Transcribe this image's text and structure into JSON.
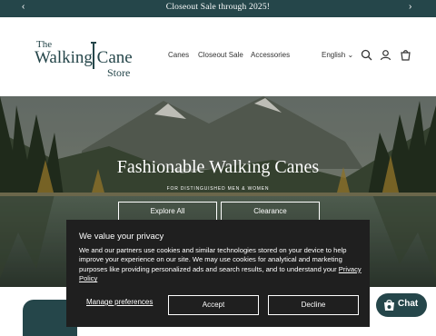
{
  "announcement": {
    "message": "Closeout Sale through 2025!",
    "prev_icon": "chevron-left-icon",
    "next_icon": "chevron-right-icon"
  },
  "header": {
    "logo": {
      "line1": "The",
      "line2": "Walking Cane",
      "line3": "Store"
    },
    "nav": [
      {
        "label": "Canes"
      },
      {
        "label": "Closeout Sale"
      },
      {
        "label": "Accessories"
      }
    ],
    "language": "English",
    "icons": [
      "search-icon",
      "account-icon",
      "cart-icon"
    ]
  },
  "hero": {
    "title": "Fashionable Walking Canes",
    "subtitle": "FOR DISTINGUISHED MEN & WOMEN",
    "buttons": [
      {
        "label": "Explore All"
      },
      {
        "label": "Clearance"
      }
    ]
  },
  "cookie": {
    "title": "We value your privacy",
    "body": "We and our partners use cookies and similar technologies stored on your device to help improve your experience on our site. We may use cookies for analytical and marketing purposes like providing personalized ads and search results, and to understand your ",
    "policy_link": "Privacy Policy",
    "manage": "Manage preferences",
    "accept": "Accept",
    "decline": "Decline"
  },
  "chat": {
    "label": "Chat"
  },
  "colors": {
    "brand": "#25464a",
    "cookie_bg": "#1f1f1f"
  }
}
